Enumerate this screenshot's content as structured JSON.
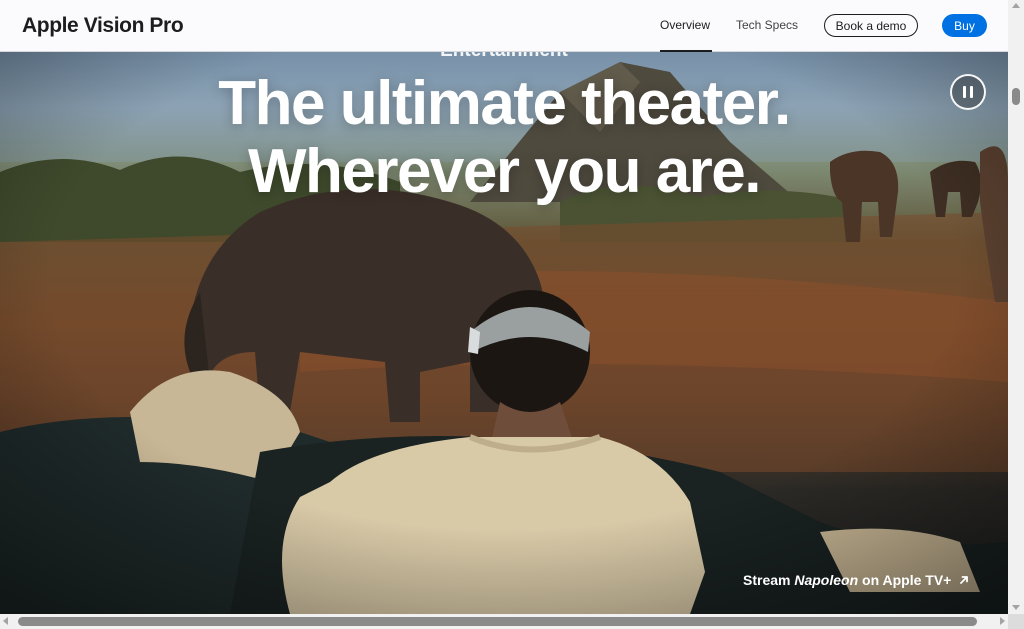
{
  "nav": {
    "product_title": "Apple Vision Pro",
    "overview_label": "Overview",
    "tech_specs_label": "Tech Specs",
    "book_demo_label": "Book a demo",
    "buy_label": "Buy"
  },
  "hero": {
    "eyebrow": "Entertainment",
    "headline_line1": "The ultimate theater.",
    "headline_line2": "Wherever you are.",
    "pause_icon": "pause-icon",
    "stream_prefix": "Stream ",
    "stream_title": "Napoleon",
    "stream_suffix": " on Apple TV+",
    "external_link_icon": "arrow-up-right-icon"
  },
  "colors": {
    "buy_button": "#0071e3",
    "nav_background": "#fbfbfd",
    "text_dark": "#1d1d1f"
  }
}
